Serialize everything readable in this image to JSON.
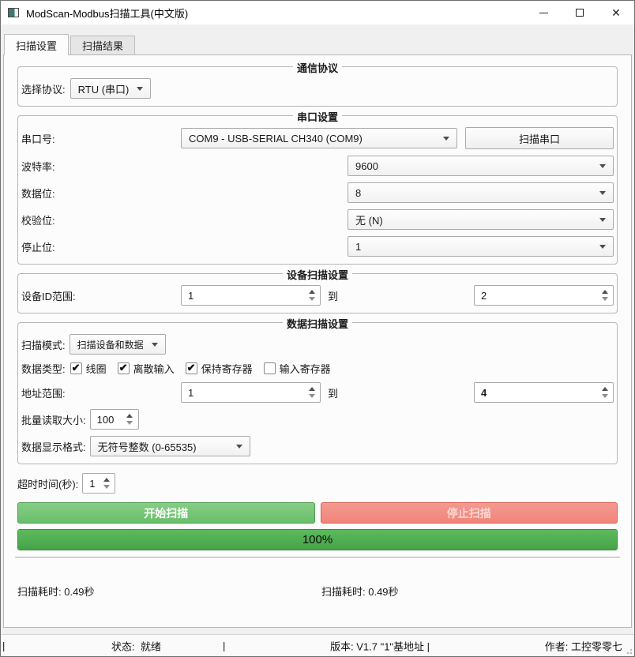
{
  "window": {
    "title": "ModScan-Modbus扫描工具(中文版)"
  },
  "tabs": {
    "settings": "扫描设置",
    "results": "扫描结果"
  },
  "protocol_group": {
    "title": "通信协议",
    "label": "选择协议:",
    "value": "RTU (串口)"
  },
  "serial_group": {
    "title": "串口设置",
    "port_label": "串口号:",
    "port_value": "COM9 - USB-SERIAL CH340 (COM9)",
    "scan_ports_button": "扫描串口",
    "baud_label": "波特率:",
    "baud_value": "9600",
    "databits_label": "数据位:",
    "databits_value": "8",
    "parity_label": "校验位:",
    "parity_value": "无 (N)",
    "stopbits_label": "停止位:",
    "stopbits_value": "1"
  },
  "device_group": {
    "title": "设备扫描设置",
    "range_label": "设备ID范围:",
    "from": "1",
    "to_label": "到",
    "to": "2"
  },
  "data_group": {
    "title": "数据扫描设置",
    "mode_label": "扫描模式:",
    "mode_value": "扫描设备和数据",
    "types_label": "数据类型:",
    "types": [
      {
        "label": "线圈",
        "checked": true
      },
      {
        "label": "离散输入",
        "checked": true
      },
      {
        "label": "保持寄存器",
        "checked": true
      },
      {
        "label": "输入寄存器",
        "checked": false
      }
    ],
    "address_label": "地址范围:",
    "address_from": "1",
    "to_label": "到",
    "address_to": "4",
    "batch_label": "批量读取大小:",
    "batch_value": "100",
    "format_label": "数据显示格式:",
    "format_value": "无符号整数 (0-65535)"
  },
  "timeout": {
    "label": "超时时间(秒):",
    "value": "1"
  },
  "actions": {
    "start": "开始扫描",
    "stop": "停止扫描"
  },
  "progress": {
    "percent": 100,
    "text": "100%"
  },
  "elapsed": {
    "left": "扫描耗时: 0.49秒",
    "center": "扫描耗时: 0.49秒"
  },
  "statusbar": {
    "sep": "|",
    "status": "状态:  就绪",
    "version": "版本: V1.7 \"1\"基地址 |",
    "author": "作者: 工控零零七"
  }
}
